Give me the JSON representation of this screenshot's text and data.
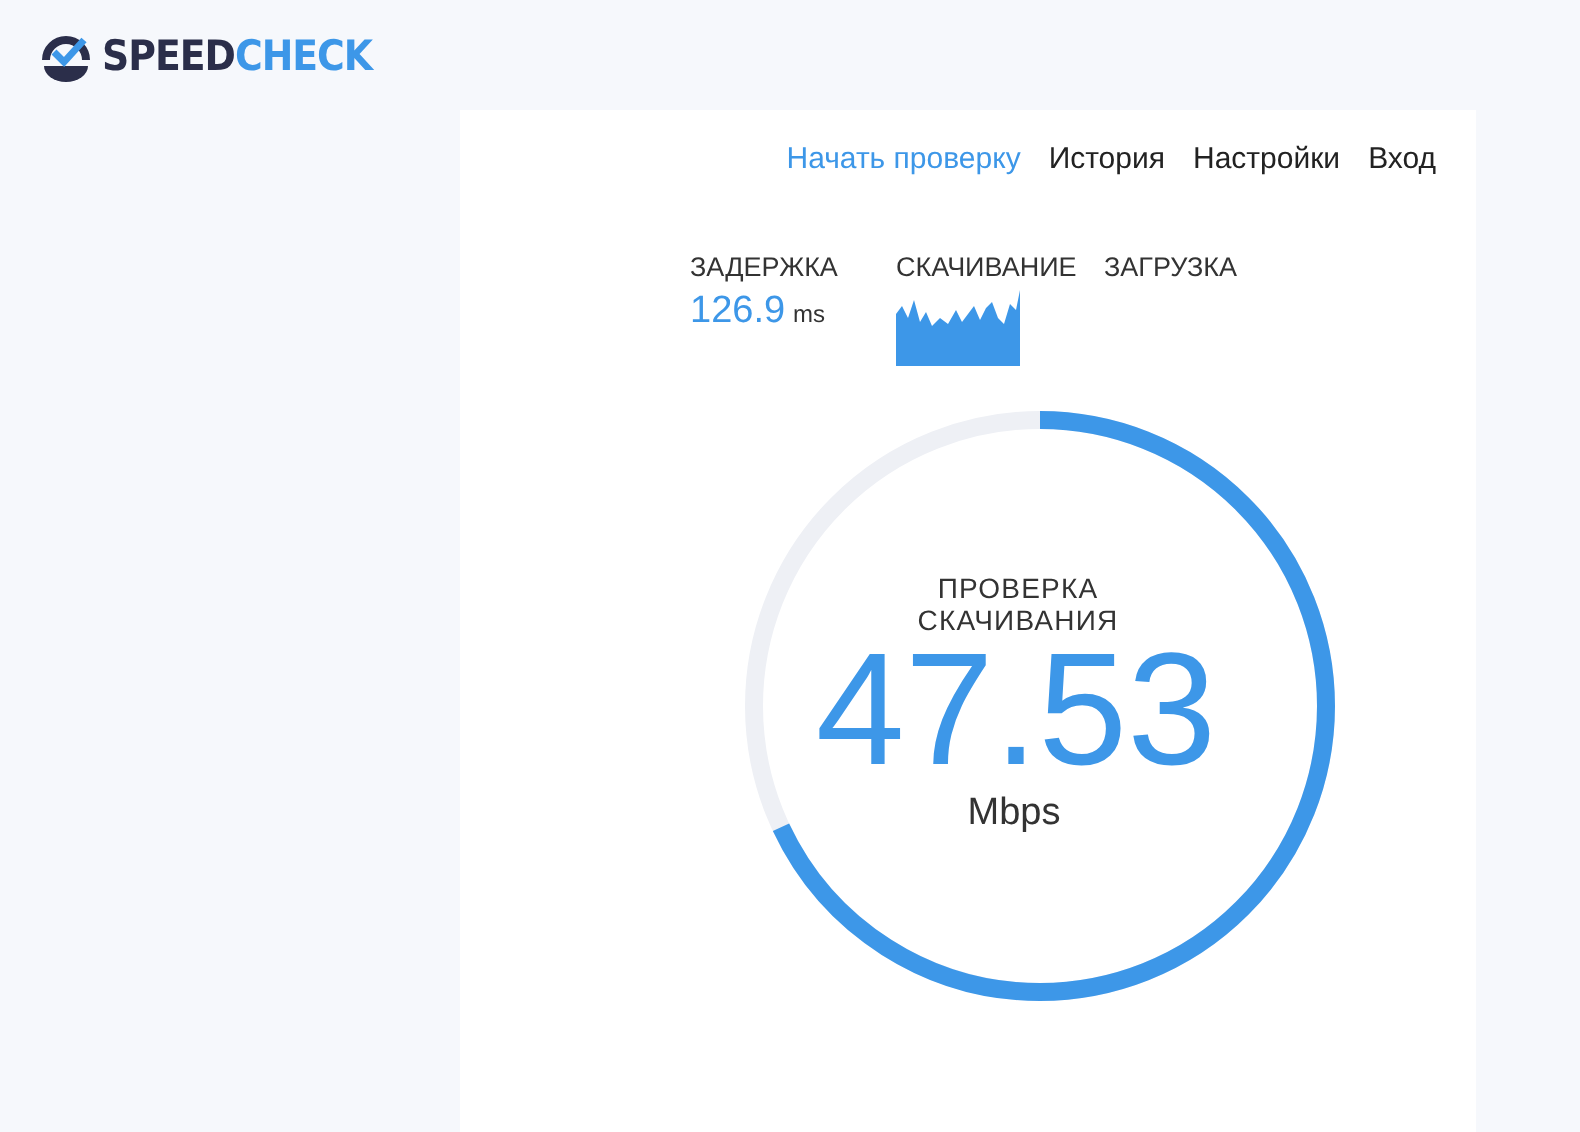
{
  "logo": {
    "dark": "SPEED",
    "accent": "CHECK"
  },
  "nav": [
    {
      "label": "Начать проверку",
      "selected": true
    },
    {
      "label": "История",
      "selected": false
    },
    {
      "label": "Настройки",
      "selected": false
    },
    {
      "label": "Вход",
      "selected": false
    }
  ],
  "stats": [
    {
      "kind": "value",
      "label": "ЗАДЕРЖКА",
      "value": "126.9",
      "unit": "ms"
    },
    {
      "kind": "graph",
      "label": "СКАЧИВАНИЕ"
    },
    {
      "kind": "empty",
      "label": "ЗАГРУЗКА"
    }
  ],
  "gauge": {
    "title": "ПРОВЕРКА СКАЧИВАНИЯ",
    "value": "47.53",
    "unit": "Mbps"
  }
}
